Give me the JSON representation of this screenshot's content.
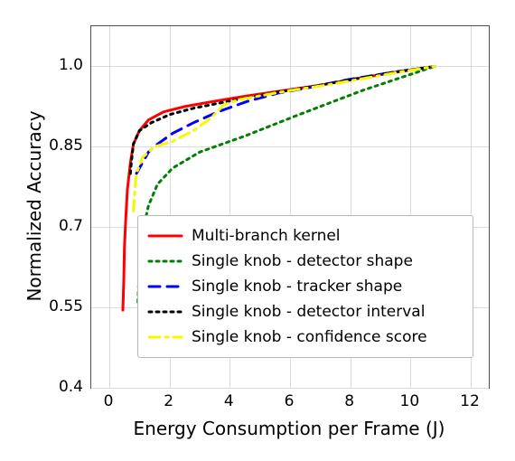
{
  "chart_data": {
    "type": "line",
    "xlabel": "Energy Consumption per Frame (J)",
    "ylabel": "Normalized Accuracy",
    "xlim": [
      -0.6,
      12.6
    ],
    "ylim": [
      0.4,
      1.075
    ],
    "xticks": [
      0,
      2,
      4,
      6,
      8,
      10,
      12
    ],
    "yticks": [
      0.4,
      0.55,
      0.7,
      0.85,
      1.0
    ],
    "xtick_labels": [
      "0",
      "2",
      "4",
      "6",
      "8",
      "10",
      "12"
    ],
    "ytick_labels": [
      "0.4",
      "0.55",
      "0.7",
      "0.85",
      "1.0"
    ],
    "series": [
      {
        "name": "Multi-branch kernel",
        "color": "#ff0000",
        "style": "solid",
        "width": 3,
        "x": [
          0.45,
          0.48,
          0.5,
          0.55,
          0.6,
          0.7,
          0.8,
          1.0,
          1.3,
          1.8,
          2.5,
          3.5,
          4.6,
          5.8,
          7.0,
          8.3,
          9.6,
          10.8
        ],
        "y": [
          0.545,
          0.6,
          0.66,
          0.72,
          0.77,
          0.82,
          0.855,
          0.88,
          0.9,
          0.915,
          0.925,
          0.935,
          0.945,
          0.955,
          0.965,
          0.978,
          0.99,
          1.0
        ]
      },
      {
        "name": "Single knob - detector shape",
        "color": "#008000",
        "style": "dotted",
        "width": 3,
        "x": [
          0.95,
          1.0,
          1.1,
          1.3,
          1.6,
          2.1,
          3.0,
          4.5,
          6.3,
          8.4,
          10.8
        ],
        "y": [
          0.56,
          0.63,
          0.69,
          0.74,
          0.78,
          0.81,
          0.84,
          0.87,
          0.91,
          0.955,
          1.0
        ]
      },
      {
        "name": "Single knob - tracker shape",
        "color": "#0000ff",
        "style": "dashed",
        "width": 3,
        "x": [
          0.9,
          1.0,
          1.1,
          1.3,
          1.6,
          2.1,
          2.8,
          3.6,
          4.6,
          5.6,
          6.6,
          7.9,
          9.3,
          10.8
        ],
        "y": [
          0.8,
          0.81,
          0.82,
          0.84,
          0.855,
          0.875,
          0.895,
          0.915,
          0.935,
          0.95,
          0.96,
          0.975,
          0.988,
          1.0
        ]
      },
      {
        "name": "Single knob - detector interval",
        "color": "#000000",
        "style": "dotted",
        "width": 3,
        "x": [
          0.7,
          0.73,
          0.8,
          1.0,
          1.4,
          2.0,
          2.8,
          3.7,
          4.6,
          5.6,
          6.8,
          8.0,
          9.3,
          10.8
        ],
        "y": [
          0.8,
          0.82,
          0.855,
          0.88,
          0.895,
          0.91,
          0.922,
          0.932,
          0.942,
          0.952,
          0.963,
          0.975,
          0.988,
          1.0
        ]
      },
      {
        "name": "Single knob - confidence score",
        "color": "#f7f700",
        "style": "dashdot",
        "width": 3,
        "x": [
          0.8,
          0.85,
          0.9,
          1.1,
          1.5,
          2.1,
          2.8,
          3.4,
          3.8,
          4.3,
          5.0,
          6.0,
          7.2,
          8.5,
          9.7,
          10.8
        ],
        "y": [
          0.73,
          0.77,
          0.8,
          0.83,
          0.85,
          0.86,
          0.88,
          0.905,
          0.928,
          0.938,
          0.945,
          0.955,
          0.965,
          0.978,
          0.99,
          1.0
        ]
      }
    ]
  }
}
